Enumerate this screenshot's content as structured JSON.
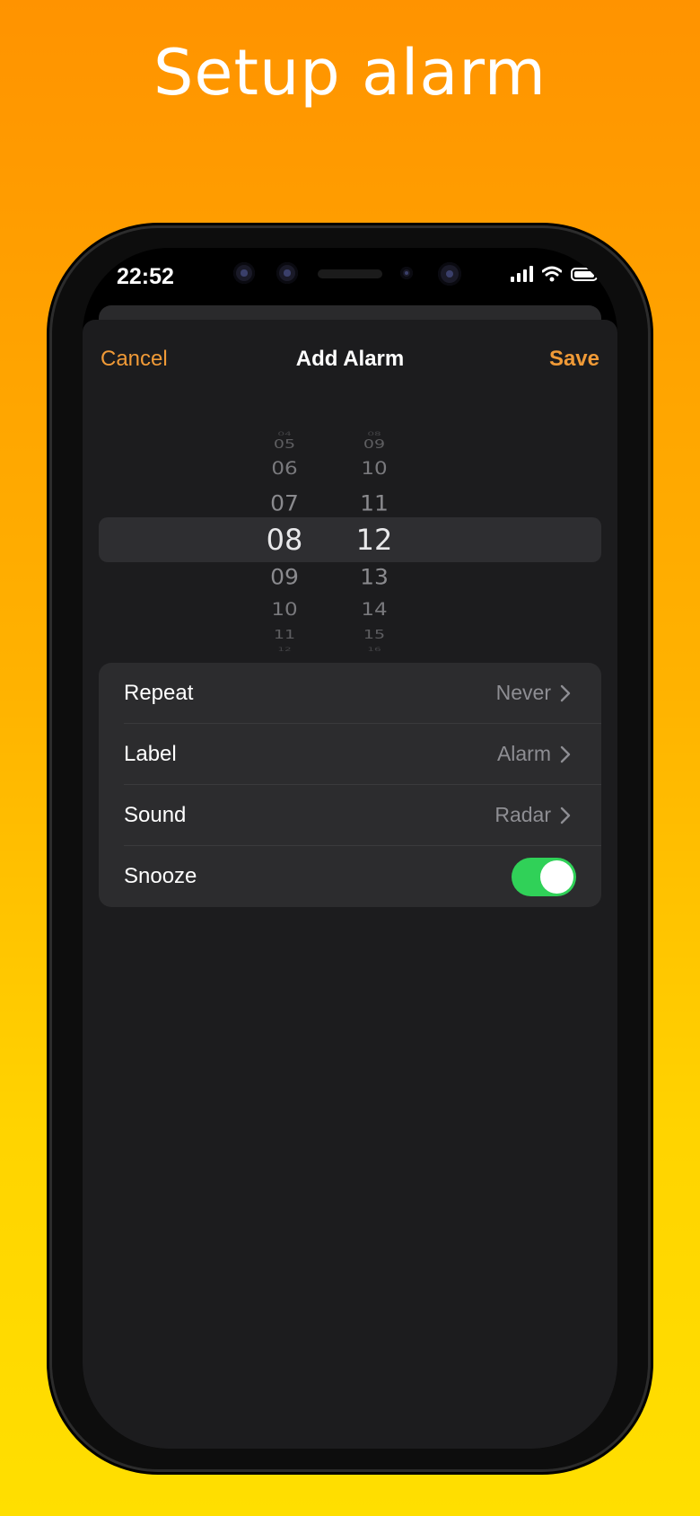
{
  "headline": "Setup alarm",
  "status_bar": {
    "time": "22:52",
    "icons": [
      "signal-icon",
      "wifi-icon",
      "battery-icon"
    ]
  },
  "nav": {
    "cancel": "Cancel",
    "title": "Add Alarm",
    "save": "Save"
  },
  "picker": {
    "hours": [
      "04",
      "05",
      "06",
      "07",
      "08",
      "09",
      "10",
      "11",
      "12"
    ],
    "minutes": [
      "08",
      "09",
      "10",
      "11",
      "12",
      "13",
      "14",
      "15",
      "16"
    ],
    "selected_hour": "08",
    "selected_minute": "12"
  },
  "settings": {
    "repeat_label": "Repeat",
    "repeat_value": "Never",
    "label_label": "Label",
    "label_value": "Alarm",
    "sound_label": "Sound",
    "sound_value": "Radar",
    "snooze_label": "Snooze",
    "snooze_on": true
  },
  "colors": {
    "accent": "#f09a37",
    "toggle_on": "#30d158",
    "sheet_bg": "#1c1c1e",
    "group_bg": "#2c2c2e"
  }
}
